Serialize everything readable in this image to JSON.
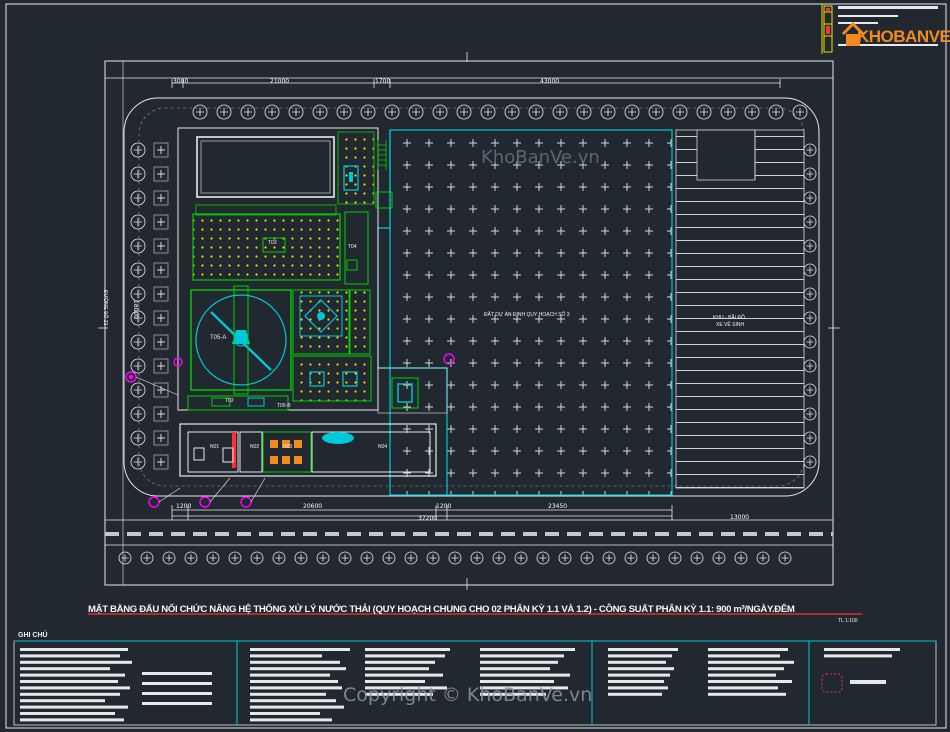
{
  "drawing": {
    "title": "MẶT BẰNG ĐẤU NỐI CHỨC NĂNG HỆ THỐNG XỬ LÝ NƯỚC THẢI  (QUY HOẠCH CHUNG CHO 02 PHÂN KỲ 1.1 VÀ 1.2) - CÔNG SUẤT PHÂN KỲ 1.1: 900 m³/NGÀY.ĐÊM",
    "scale": "TL 1:100",
    "notes_heading": "GHI CHÚ"
  },
  "site": {
    "plot_label": "ĐẤT DỰ ÁN ĐỊNH QUY HOẠCH SỐ 3",
    "right_label_line1": "KHU - BÃI ĐỖ",
    "right_label_line2": "XE VỆ SINH",
    "road_label": "ĐƯỜNG SỐ 23"
  },
  "units": {
    "t05a": "T05-A",
    "t05b": "T05-B",
    "t04": "T04",
    "t03": "T03",
    "t02": "T02",
    "n01": "N01",
    "n02": "N02",
    "n03": "N03",
    "n04": "N04"
  },
  "dimensions": {
    "top": [
      "3000",
      "21000",
      "1700",
      "43000"
    ],
    "bottom": [
      "1200",
      "20600",
      "1200",
      "23450",
      "13000"
    ],
    "bottom_total": "37200",
    "left": "18000"
  },
  "logo": {
    "text": "KHOBANVE"
  },
  "watermarks": {
    "top": "KhoBanVe.vn",
    "bottom": "Copyright © KhoBanVe.vn"
  },
  "colors": {
    "background": "#212830",
    "cad_white": "#e8e8e8",
    "cad_yellow": "#f0e000",
    "cad_green": "#00d000",
    "cad_cyan": "#00c8d8",
    "cad_magenta": "#ff00ff",
    "title_red": "#ff3030",
    "logo_orange": "#f28a1e"
  }
}
